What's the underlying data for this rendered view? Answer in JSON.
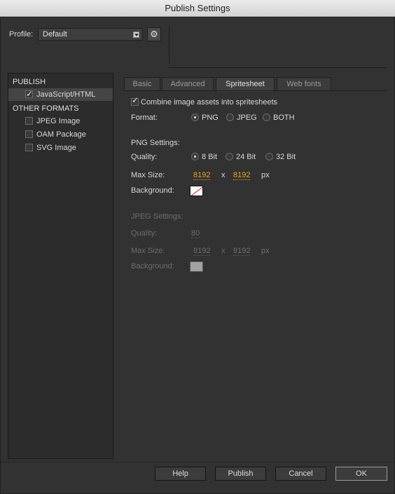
{
  "window": {
    "title": "Publish Settings"
  },
  "profile": {
    "label": "Profile:",
    "value": "Default"
  },
  "sidebar": {
    "publish_header": "PUBLISH",
    "other_header": "OTHER FORMATS",
    "items": [
      {
        "label": "JavaScript/HTML",
        "checked": true
      },
      {
        "label": "JPEG Image",
        "checked": false
      },
      {
        "label": "OAM Package",
        "checked": false
      },
      {
        "label": "SVG Image",
        "checked": false
      }
    ]
  },
  "tabs": [
    "Basic",
    "Advanced",
    "Spritesheet",
    "Web fonts"
  ],
  "spritesheet": {
    "combine_label": "Combine image assets into spritesheets",
    "format_label": "Format:",
    "format_options": [
      "PNG",
      "JPEG",
      "BOTH"
    ],
    "png": {
      "header": "PNG Settings:",
      "quality_label": "Quality:",
      "quality_options": [
        "8 Bit",
        "24 Bit",
        "32 Bit"
      ],
      "max_size_label": "Max Size:",
      "width": "8192",
      "x": "x",
      "height": "8192",
      "unit": "px",
      "background_label": "Background:"
    },
    "jpeg": {
      "header": "JPEG Settings:",
      "quality_label": "Quality:",
      "quality": "80",
      "max_size_label": "Max Size:",
      "width": "8192",
      "x": "x",
      "height": "8192",
      "unit": "px",
      "background_label": "Background:"
    }
  },
  "footer": {
    "help": "Help",
    "publish": "Publish",
    "cancel": "Cancel",
    "ok": "OK"
  },
  "icons": {
    "gear": "gear-icon",
    "dropdown": "chevron-down-icon"
  }
}
